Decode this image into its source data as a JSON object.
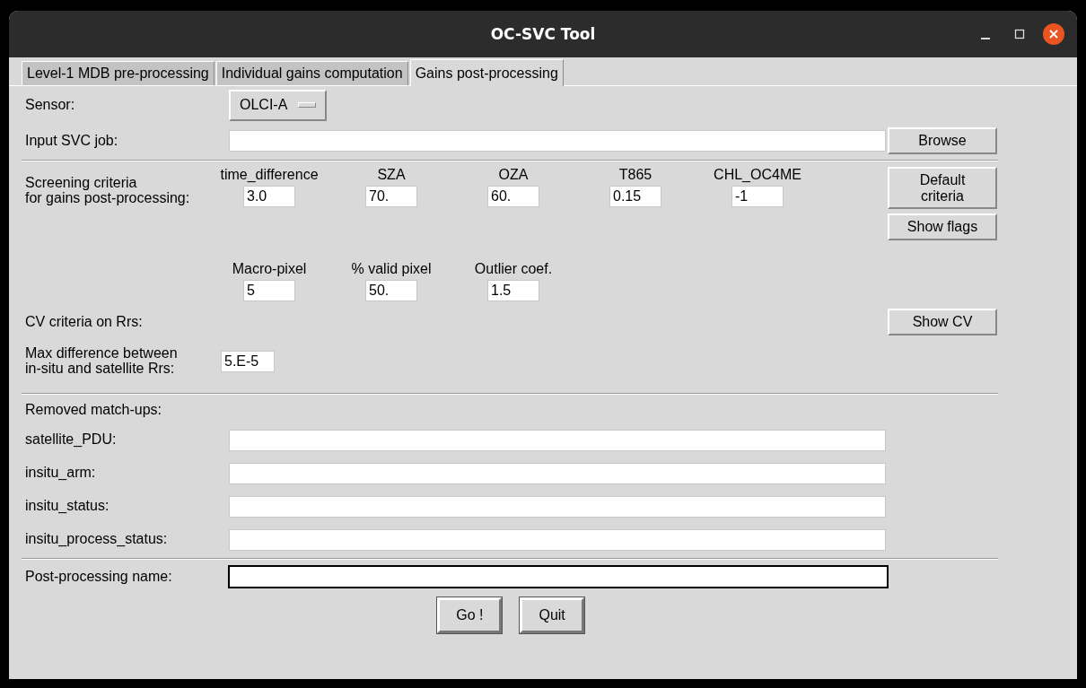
{
  "window": {
    "title": "OC-SVC Tool"
  },
  "tabs": [
    {
      "label": "Level-1 MDB pre-processing",
      "selected": false
    },
    {
      "label": "Individual gains computation",
      "selected": false
    },
    {
      "label": "Gains post-processing",
      "selected": true
    }
  ],
  "sensor": {
    "label": "Sensor:",
    "value": "OLCI-A"
  },
  "input_job": {
    "label": "Input SVC job:",
    "button": "Browse"
  },
  "screening": {
    "label": "Screening criteria\nfor gains post-processing:",
    "criteria": [
      {
        "label": "time_difference",
        "value": "3.0"
      },
      {
        "label": "SZA",
        "value": "70."
      },
      {
        "label": "OZA",
        "value": "60."
      },
      {
        "label": "T865",
        "value": "0.15"
      },
      {
        "label": "CHL_OC4ME",
        "value": "-1"
      }
    ],
    "criteria_2": [
      {
        "label": "Macro-pixel",
        "value": "5"
      },
      {
        "label": "% valid pixel",
        "value": "50."
      },
      {
        "label": "Outlier coef.",
        "value": "1.5"
      }
    ],
    "buttons": [
      "Default\ncriteria",
      "Show flags"
    ]
  },
  "cv": {
    "label": "CV criteria on Rrs:",
    "button": "Show CV"
  },
  "max_diff": {
    "label": "Max difference between\nin-situ and satellite Rrs:",
    "value": "5.E-5"
  },
  "removed": {
    "label": "Removed match-ups:",
    "fields": [
      {
        "label": "satellite_PDU:"
      },
      {
        "label": "insitu_arm:"
      },
      {
        "label": "insitu_status:"
      },
      {
        "label": "insitu_process_status:"
      }
    ]
  },
  "post_name": {
    "label": "Post-processing name:",
    "focused": true
  },
  "buttons": [
    "Go !",
    "Quit"
  ]
}
